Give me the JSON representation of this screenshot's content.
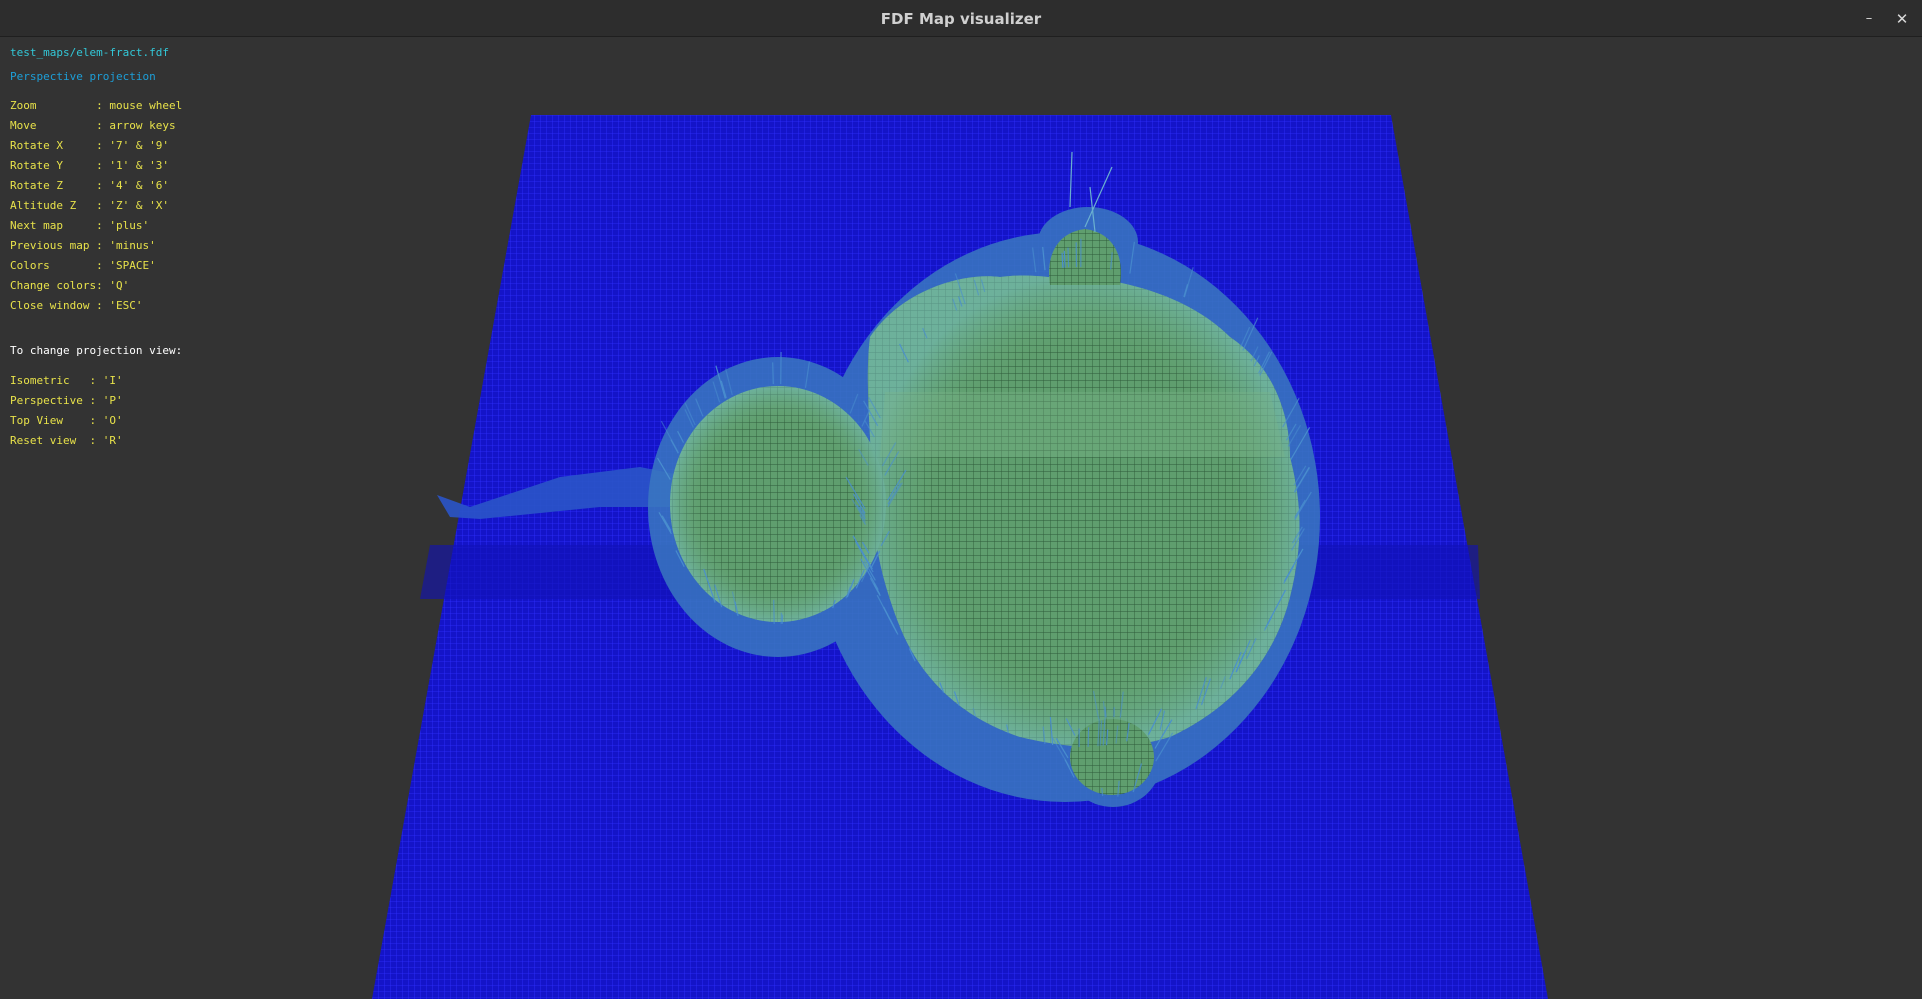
{
  "window": {
    "title": "FDF Map visualizer",
    "minimize_glyph": "–",
    "close_glyph": "✕"
  },
  "hud": {
    "map_file": "test_maps/elem-fract.fdf",
    "projection": "Perspective projection",
    "controls": [
      {
        "text": "Zoom         : mouse wheel"
      },
      {
        "text": "Move         : arrow keys"
      },
      {
        "text": "Rotate X     : '7' & '9'"
      },
      {
        "text": "Rotate Y     : '1' & '3'"
      },
      {
        "text": "Rotate Z     : '4' & '6'"
      },
      {
        "text": "Altitude Z   : 'Z' & 'X'"
      },
      {
        "text": "Next map     : 'plus'"
      },
      {
        "text": "Previous map : 'minus'"
      },
      {
        "text": "Colors       : 'SPACE'"
      },
      {
        "text": "Change colors: 'Q'"
      },
      {
        "text": "Close window : 'ESC'"
      }
    ],
    "projection_heading": "To change projection view:",
    "projection_keys": [
      {
        "text": "Isometric   : 'I'"
      },
      {
        "text": "Perspective : 'P'"
      },
      {
        "text": "Top View    : 'O'"
      },
      {
        "text": "Reset view  : 'R'"
      }
    ]
  },
  "colors": {
    "background": "#333333",
    "map_low": "#1414c8",
    "map_grid": "#2a2aff",
    "map_high": "#5f9e6e",
    "map_high_grid": "#2e5a3a",
    "text_file": "#33c8d8",
    "text_projection": "#1d9fd8",
    "text_controls": "#e8e24a",
    "text_heading": "#ffffff"
  }
}
